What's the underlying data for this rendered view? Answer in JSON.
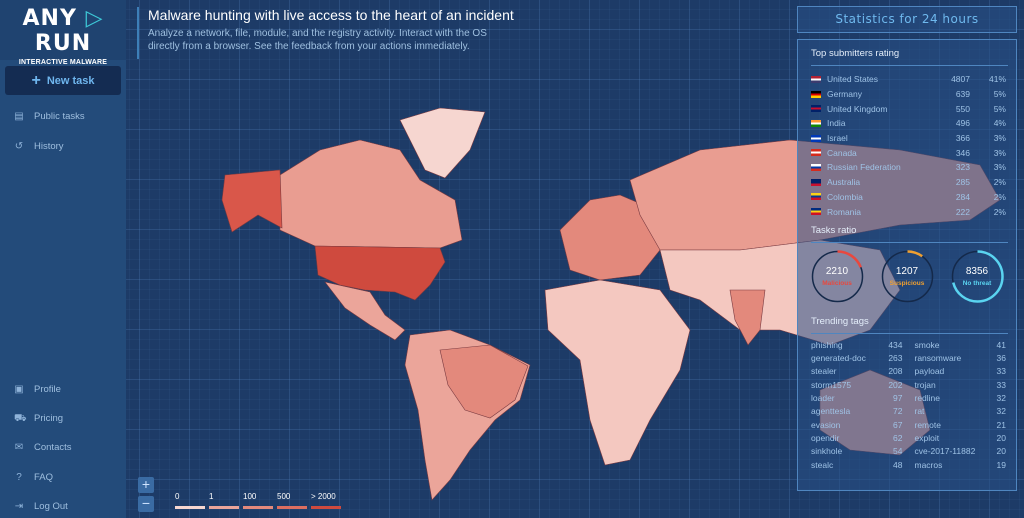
{
  "brand": {
    "name_left": "ANY",
    "name_right": "RUN",
    "tagline": "INTERACTIVE MALWARE ANALYSIS"
  },
  "sidebar": {
    "new_task": "New task",
    "items": [
      {
        "label": "Public tasks",
        "icon": "document-icon"
      },
      {
        "label": "History",
        "icon": "history-icon"
      }
    ],
    "bottom_items": [
      {
        "label": "Profile",
        "icon": "profile-icon"
      },
      {
        "label": "Pricing",
        "icon": "cart-icon"
      },
      {
        "label": "Contacts",
        "icon": "mail-icon"
      },
      {
        "label": "FAQ",
        "icon": "help-icon"
      },
      {
        "label": "Log Out",
        "icon": "logout-icon"
      }
    ]
  },
  "header": {
    "title": "Malware hunting with live access to the heart of an incident",
    "subtitle": "Analyze a network, file, module, and the registry activity. Interact with the OS directly from a browser. See the feedback from your actions immediately."
  },
  "map": {
    "zoom_in": "+",
    "zoom_out": "−",
    "legend": [
      {
        "label": "0",
        "color": "#f6d6d0"
      },
      {
        "label": "1",
        "color": "#eba59a"
      },
      {
        "label": "100",
        "color": "#e3897c"
      },
      {
        "label": "500",
        "color": "#dc6e60"
      },
      {
        "label": "> 2000",
        "color": "#cf4a3e"
      }
    ]
  },
  "stats": {
    "title": "Statistics for 24 hours",
    "submitters_title": "Top submitters rating",
    "submitters": [
      {
        "country": "United States",
        "count": "4807",
        "pct": "41%",
        "flag": [
          "#b22234",
          "#fff",
          "#3c3b6e"
        ]
      },
      {
        "country": "Germany",
        "count": "639",
        "pct": "5%",
        "flag": [
          "#000",
          "#dd0000",
          "#ffce00"
        ]
      },
      {
        "country": "United Kingdom",
        "count": "550",
        "pct": "5%",
        "flag": [
          "#012169",
          "#c8102e",
          "#012169"
        ]
      },
      {
        "country": "India",
        "count": "496",
        "pct": "4%",
        "flag": [
          "#ff9933",
          "#fff",
          "#138808"
        ]
      },
      {
        "country": "Israel",
        "count": "366",
        "pct": "3%",
        "flag": [
          "#0038b8",
          "#fff",
          "#0038b8"
        ]
      },
      {
        "country": "Canada",
        "count": "346",
        "pct": "3%",
        "flag": [
          "#d52b1e",
          "#fff",
          "#d52b1e"
        ]
      },
      {
        "country": "Russian Federation",
        "count": "323",
        "pct": "3%",
        "flag": [
          "#fff",
          "#0039a6",
          "#d52b1e"
        ]
      },
      {
        "country": "Australia",
        "count": "285",
        "pct": "2%",
        "flag": [
          "#012169",
          "#012169",
          "#c8102e"
        ]
      },
      {
        "country": "Colombia",
        "count": "284",
        "pct": "2%",
        "flag": [
          "#fcd116",
          "#003893",
          "#ce1126"
        ]
      },
      {
        "country": "Romania",
        "count": "222",
        "pct": "2%",
        "flag": [
          "#002b7f",
          "#fcd116",
          "#ce1126"
        ]
      }
    ],
    "ratio_title": "Tasks ratio",
    "ratio": [
      {
        "value": "2210",
        "label": "Malicious",
        "color": "#e8483e",
        "fraction": 0.19
      },
      {
        "value": "1207",
        "label": "Suspicious",
        "color": "#f0a030",
        "fraction": 0.1
      },
      {
        "value": "8356",
        "label": "No threat",
        "color": "#5ad4f0",
        "fraction": 0.71
      }
    ],
    "tags_title": "Trending tags",
    "tags_left": [
      [
        "phishing",
        "434"
      ],
      [
        "generated-doc",
        "263"
      ],
      [
        "stealer",
        "208"
      ],
      [
        "storm1575",
        "202"
      ],
      [
        "loader",
        "97"
      ],
      [
        "agenttesla",
        "72"
      ],
      [
        "evasion",
        "67"
      ],
      [
        "opendir",
        "62"
      ],
      [
        "sinkhole",
        "54"
      ],
      [
        "stealc",
        "48"
      ]
    ],
    "tags_right": [
      [
        "smoke",
        "41"
      ],
      [
        "ransomware",
        "36"
      ],
      [
        "payload",
        "33"
      ],
      [
        "trojan",
        "33"
      ],
      [
        "redline",
        "32"
      ],
      [
        "rat",
        "32"
      ],
      [
        "remote",
        "21"
      ],
      [
        "exploit",
        "20"
      ],
      [
        "cve-2017-11882",
        "20"
      ],
      [
        "macros",
        "19"
      ]
    ]
  }
}
